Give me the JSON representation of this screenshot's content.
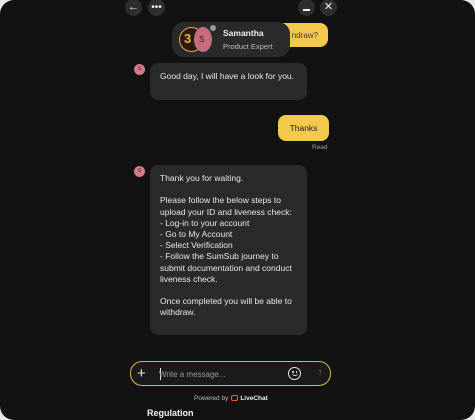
{
  "topbar": {
    "back_icon": "arrow-left-icon",
    "more_icon": "more-horizontal-icon",
    "minimize_icon": "minimize-icon",
    "close_icon": "close-icon",
    "back_glyph": "←",
    "more_glyph": "•••",
    "close_glyph": "✕"
  },
  "agent": {
    "name": "Samantha",
    "role": "Product Expert",
    "initial": "S",
    "badge_number": "3"
  },
  "peek_bubble": {
    "text": "ndraw?"
  },
  "messages": [
    {
      "from": "agent",
      "avatar": "S",
      "text": "Good day, I will have a look for you."
    },
    {
      "from": "user",
      "text": "Thanks",
      "status": "Read"
    },
    {
      "from": "agent",
      "avatar": "S",
      "text": "Thank you for waiting.\n\nPlease follow the below steps to upload your ID and liveness check:\n- Log-in to your account\n- Go to My Account\n- Select Verification\n- Follow the SumSub journey to submit documentation and conduct liveness check.\n\nOnce completed you will be able to withdraw."
    }
  ],
  "composer": {
    "placeholder": "Write a message...",
    "add_glyph": "+",
    "send_glyph": "↑"
  },
  "footer": {
    "powered_by": "Powered by",
    "brand": "LiveChat"
  },
  "regulation": {
    "label": "Regulation"
  },
  "colors": {
    "background": "#121212",
    "bubble_agent": "#2a2a2a",
    "bubble_user": "#f2c94c",
    "accent": "#f2c94c"
  }
}
